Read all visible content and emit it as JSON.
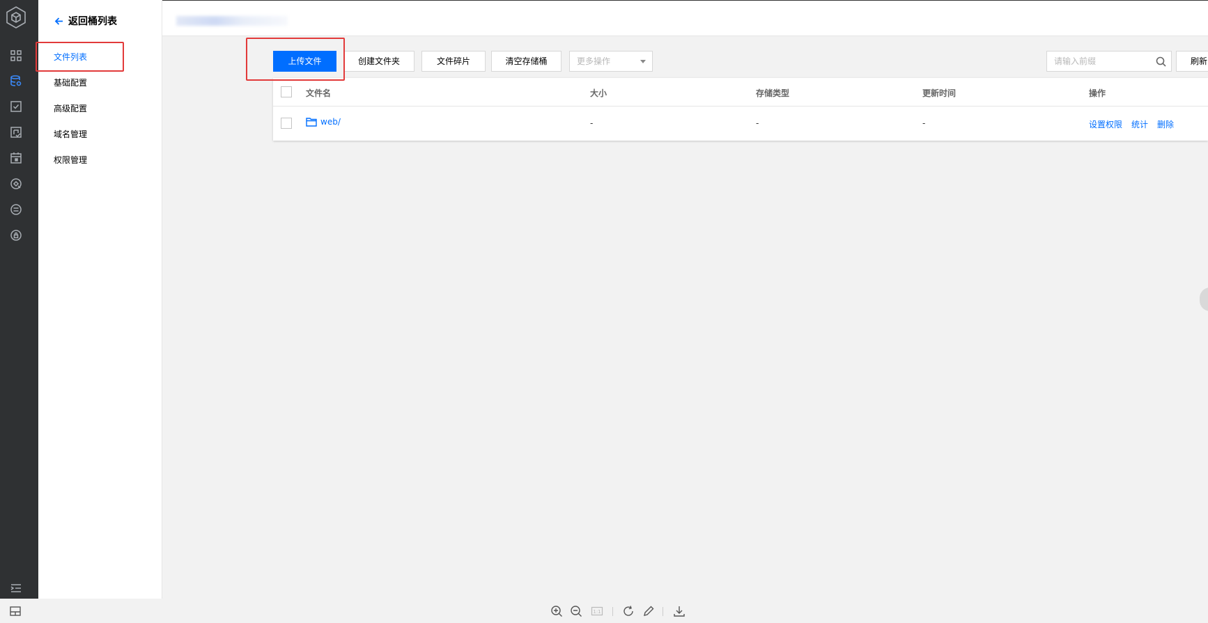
{
  "app": {
    "rail_icons": [
      "cube-logo-icon",
      "dashboard-icon",
      "bucket-icon",
      "task-check-icon",
      "image-check-icon",
      "calendar-icon",
      "monitor-icon",
      "menu-circle-icon",
      "lock-circle-icon",
      "collapse-menu-icon"
    ],
    "accent_color": "#006eff",
    "highlight_color": "#e23a3a"
  },
  "sidenav": {
    "back_label": "返回桶列表",
    "items": [
      {
        "label": "文件列表",
        "active": true
      },
      {
        "label": "基础配置",
        "active": false
      },
      {
        "label": "高级配置",
        "active": false
      },
      {
        "label": "域名管理",
        "active": false
      },
      {
        "label": "权限管理",
        "active": false
      }
    ]
  },
  "toolbar": {
    "upload_label": "上传文件",
    "create_folder_label": "创建文件夹",
    "fragments_label": "文件碎片",
    "clear_bucket_label": "清空存储桶",
    "more_actions_placeholder": "更多操作",
    "search_placeholder": "请输入前缀",
    "refresh_label": "刷新"
  },
  "table": {
    "columns": [
      "文件名",
      "大小",
      "存储类型",
      "更新时间",
      "操作"
    ],
    "rows": [
      {
        "name": "web/",
        "size": "-",
        "storage_class": "-",
        "updated": "-",
        "actions": [
          "设置权限",
          "统计",
          "删除"
        ]
      }
    ]
  },
  "viewer": {
    "icons": [
      "layout-icon",
      "zoom-in-icon",
      "zoom-out-icon",
      "actual-size-icon",
      "rotate-icon",
      "edit-icon",
      "download-icon"
    ],
    "actual_size_label": "1:1"
  }
}
